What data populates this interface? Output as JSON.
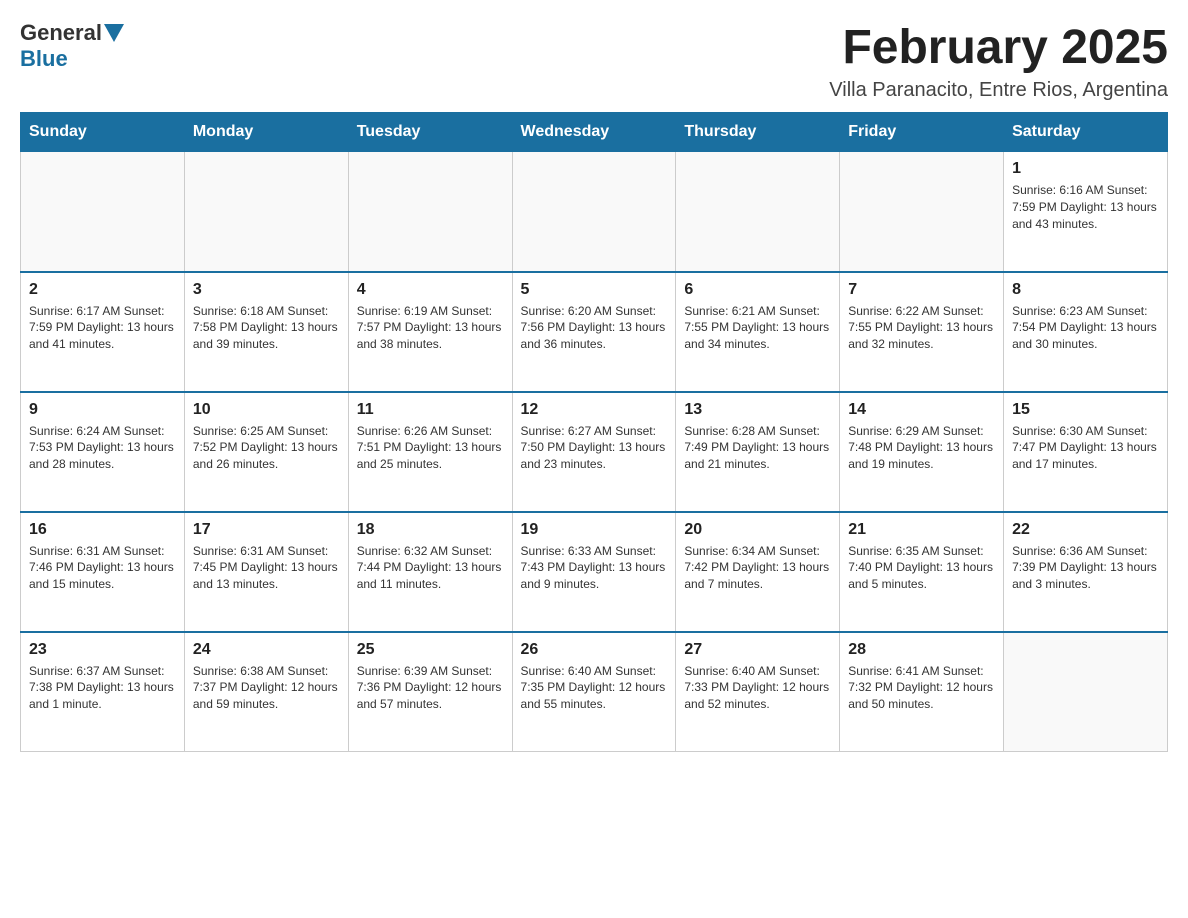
{
  "header": {
    "logo_general": "General",
    "logo_blue": "Blue",
    "month_title": "February 2025",
    "location": "Villa Paranacito, Entre Rios, Argentina"
  },
  "days_of_week": [
    "Sunday",
    "Monday",
    "Tuesday",
    "Wednesday",
    "Thursday",
    "Friday",
    "Saturday"
  ],
  "weeks": [
    [
      {
        "day": "",
        "info": ""
      },
      {
        "day": "",
        "info": ""
      },
      {
        "day": "",
        "info": ""
      },
      {
        "day": "",
        "info": ""
      },
      {
        "day": "",
        "info": ""
      },
      {
        "day": "",
        "info": ""
      },
      {
        "day": "1",
        "info": "Sunrise: 6:16 AM\nSunset: 7:59 PM\nDaylight: 13 hours and 43 minutes."
      }
    ],
    [
      {
        "day": "2",
        "info": "Sunrise: 6:17 AM\nSunset: 7:59 PM\nDaylight: 13 hours and 41 minutes."
      },
      {
        "day": "3",
        "info": "Sunrise: 6:18 AM\nSunset: 7:58 PM\nDaylight: 13 hours and 39 minutes."
      },
      {
        "day": "4",
        "info": "Sunrise: 6:19 AM\nSunset: 7:57 PM\nDaylight: 13 hours and 38 minutes."
      },
      {
        "day": "5",
        "info": "Sunrise: 6:20 AM\nSunset: 7:56 PM\nDaylight: 13 hours and 36 minutes."
      },
      {
        "day": "6",
        "info": "Sunrise: 6:21 AM\nSunset: 7:55 PM\nDaylight: 13 hours and 34 minutes."
      },
      {
        "day": "7",
        "info": "Sunrise: 6:22 AM\nSunset: 7:55 PM\nDaylight: 13 hours and 32 minutes."
      },
      {
        "day": "8",
        "info": "Sunrise: 6:23 AM\nSunset: 7:54 PM\nDaylight: 13 hours and 30 minutes."
      }
    ],
    [
      {
        "day": "9",
        "info": "Sunrise: 6:24 AM\nSunset: 7:53 PM\nDaylight: 13 hours and 28 minutes."
      },
      {
        "day": "10",
        "info": "Sunrise: 6:25 AM\nSunset: 7:52 PM\nDaylight: 13 hours and 26 minutes."
      },
      {
        "day": "11",
        "info": "Sunrise: 6:26 AM\nSunset: 7:51 PM\nDaylight: 13 hours and 25 minutes."
      },
      {
        "day": "12",
        "info": "Sunrise: 6:27 AM\nSunset: 7:50 PM\nDaylight: 13 hours and 23 minutes."
      },
      {
        "day": "13",
        "info": "Sunrise: 6:28 AM\nSunset: 7:49 PM\nDaylight: 13 hours and 21 minutes."
      },
      {
        "day": "14",
        "info": "Sunrise: 6:29 AM\nSunset: 7:48 PM\nDaylight: 13 hours and 19 minutes."
      },
      {
        "day": "15",
        "info": "Sunrise: 6:30 AM\nSunset: 7:47 PM\nDaylight: 13 hours and 17 minutes."
      }
    ],
    [
      {
        "day": "16",
        "info": "Sunrise: 6:31 AM\nSunset: 7:46 PM\nDaylight: 13 hours and 15 minutes."
      },
      {
        "day": "17",
        "info": "Sunrise: 6:31 AM\nSunset: 7:45 PM\nDaylight: 13 hours and 13 minutes."
      },
      {
        "day": "18",
        "info": "Sunrise: 6:32 AM\nSunset: 7:44 PM\nDaylight: 13 hours and 11 minutes."
      },
      {
        "day": "19",
        "info": "Sunrise: 6:33 AM\nSunset: 7:43 PM\nDaylight: 13 hours and 9 minutes."
      },
      {
        "day": "20",
        "info": "Sunrise: 6:34 AM\nSunset: 7:42 PM\nDaylight: 13 hours and 7 minutes."
      },
      {
        "day": "21",
        "info": "Sunrise: 6:35 AM\nSunset: 7:40 PM\nDaylight: 13 hours and 5 minutes."
      },
      {
        "day": "22",
        "info": "Sunrise: 6:36 AM\nSunset: 7:39 PM\nDaylight: 13 hours and 3 minutes."
      }
    ],
    [
      {
        "day": "23",
        "info": "Sunrise: 6:37 AM\nSunset: 7:38 PM\nDaylight: 13 hours and 1 minute."
      },
      {
        "day": "24",
        "info": "Sunrise: 6:38 AM\nSunset: 7:37 PM\nDaylight: 12 hours and 59 minutes."
      },
      {
        "day": "25",
        "info": "Sunrise: 6:39 AM\nSunset: 7:36 PM\nDaylight: 12 hours and 57 minutes."
      },
      {
        "day": "26",
        "info": "Sunrise: 6:40 AM\nSunset: 7:35 PM\nDaylight: 12 hours and 55 minutes."
      },
      {
        "day": "27",
        "info": "Sunrise: 6:40 AM\nSunset: 7:33 PM\nDaylight: 12 hours and 52 minutes."
      },
      {
        "day": "28",
        "info": "Sunrise: 6:41 AM\nSunset: 7:32 PM\nDaylight: 12 hours and 50 minutes."
      },
      {
        "day": "",
        "info": ""
      }
    ]
  ]
}
